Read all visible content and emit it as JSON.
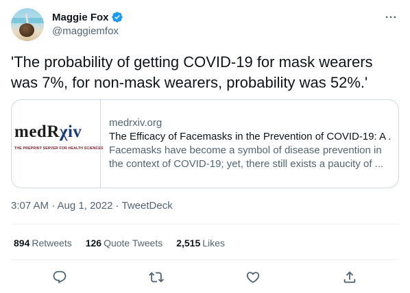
{
  "author": {
    "display_name": "Maggie Fox",
    "handle": "@maggiemfox"
  },
  "icons": {
    "verified": "verified-badge-icon",
    "more": "more-options-icon",
    "reply": "reply-icon",
    "retweet": "retweet-icon",
    "like": "like-icon",
    "share": "share-icon"
  },
  "colors": {
    "verified": "#1d9bf0",
    "text_primary": "#0f1419",
    "text_secondary": "#536471",
    "border": "#cfd9de",
    "logo_accent": "#1d3b7a",
    "logo_subtitle": "#7d1f2c"
  },
  "tweet": {
    "text": "'The probability of getting COVID-19 for mask wearers was 7%, for non-mask wearers, probability was 52%.'",
    "timestamp": "3:07 AM · Aug 1, 2022 · TweetDeck"
  },
  "card": {
    "logo_main": "medR",
    "logo_accent": "χiv",
    "logo_subtitle": "THE PREPRINT SERVER FOR HEALTH SCIENCES",
    "domain": "medrxiv.org",
    "title": "The Efficacy of Facemasks in the Prevention of COVID-19: A ...",
    "description": "Facemasks have become a symbol of disease prevention in the context of COVID-19; yet, there still exists a paucity of ..."
  },
  "stats": {
    "retweets": {
      "count": "894",
      "label": "Retweets"
    },
    "quote_tweets": {
      "count": "126",
      "label": "Quote Tweets"
    },
    "likes": {
      "count": "2,515",
      "label": "Likes"
    }
  }
}
